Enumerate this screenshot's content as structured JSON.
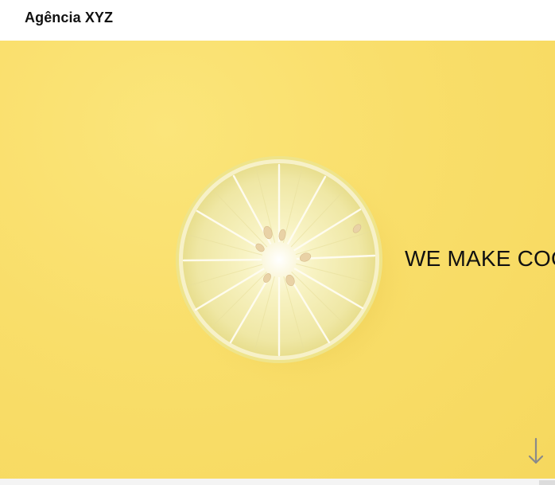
{
  "navbar": {
    "brand": "Agência XYZ"
  },
  "hero": {
    "headline": "WE MAKE COOL STUFF",
    "scroll_icon": "arrow-down-icon",
    "background_color": "#f9de6a",
    "image_subject": "lemon-slice"
  }
}
